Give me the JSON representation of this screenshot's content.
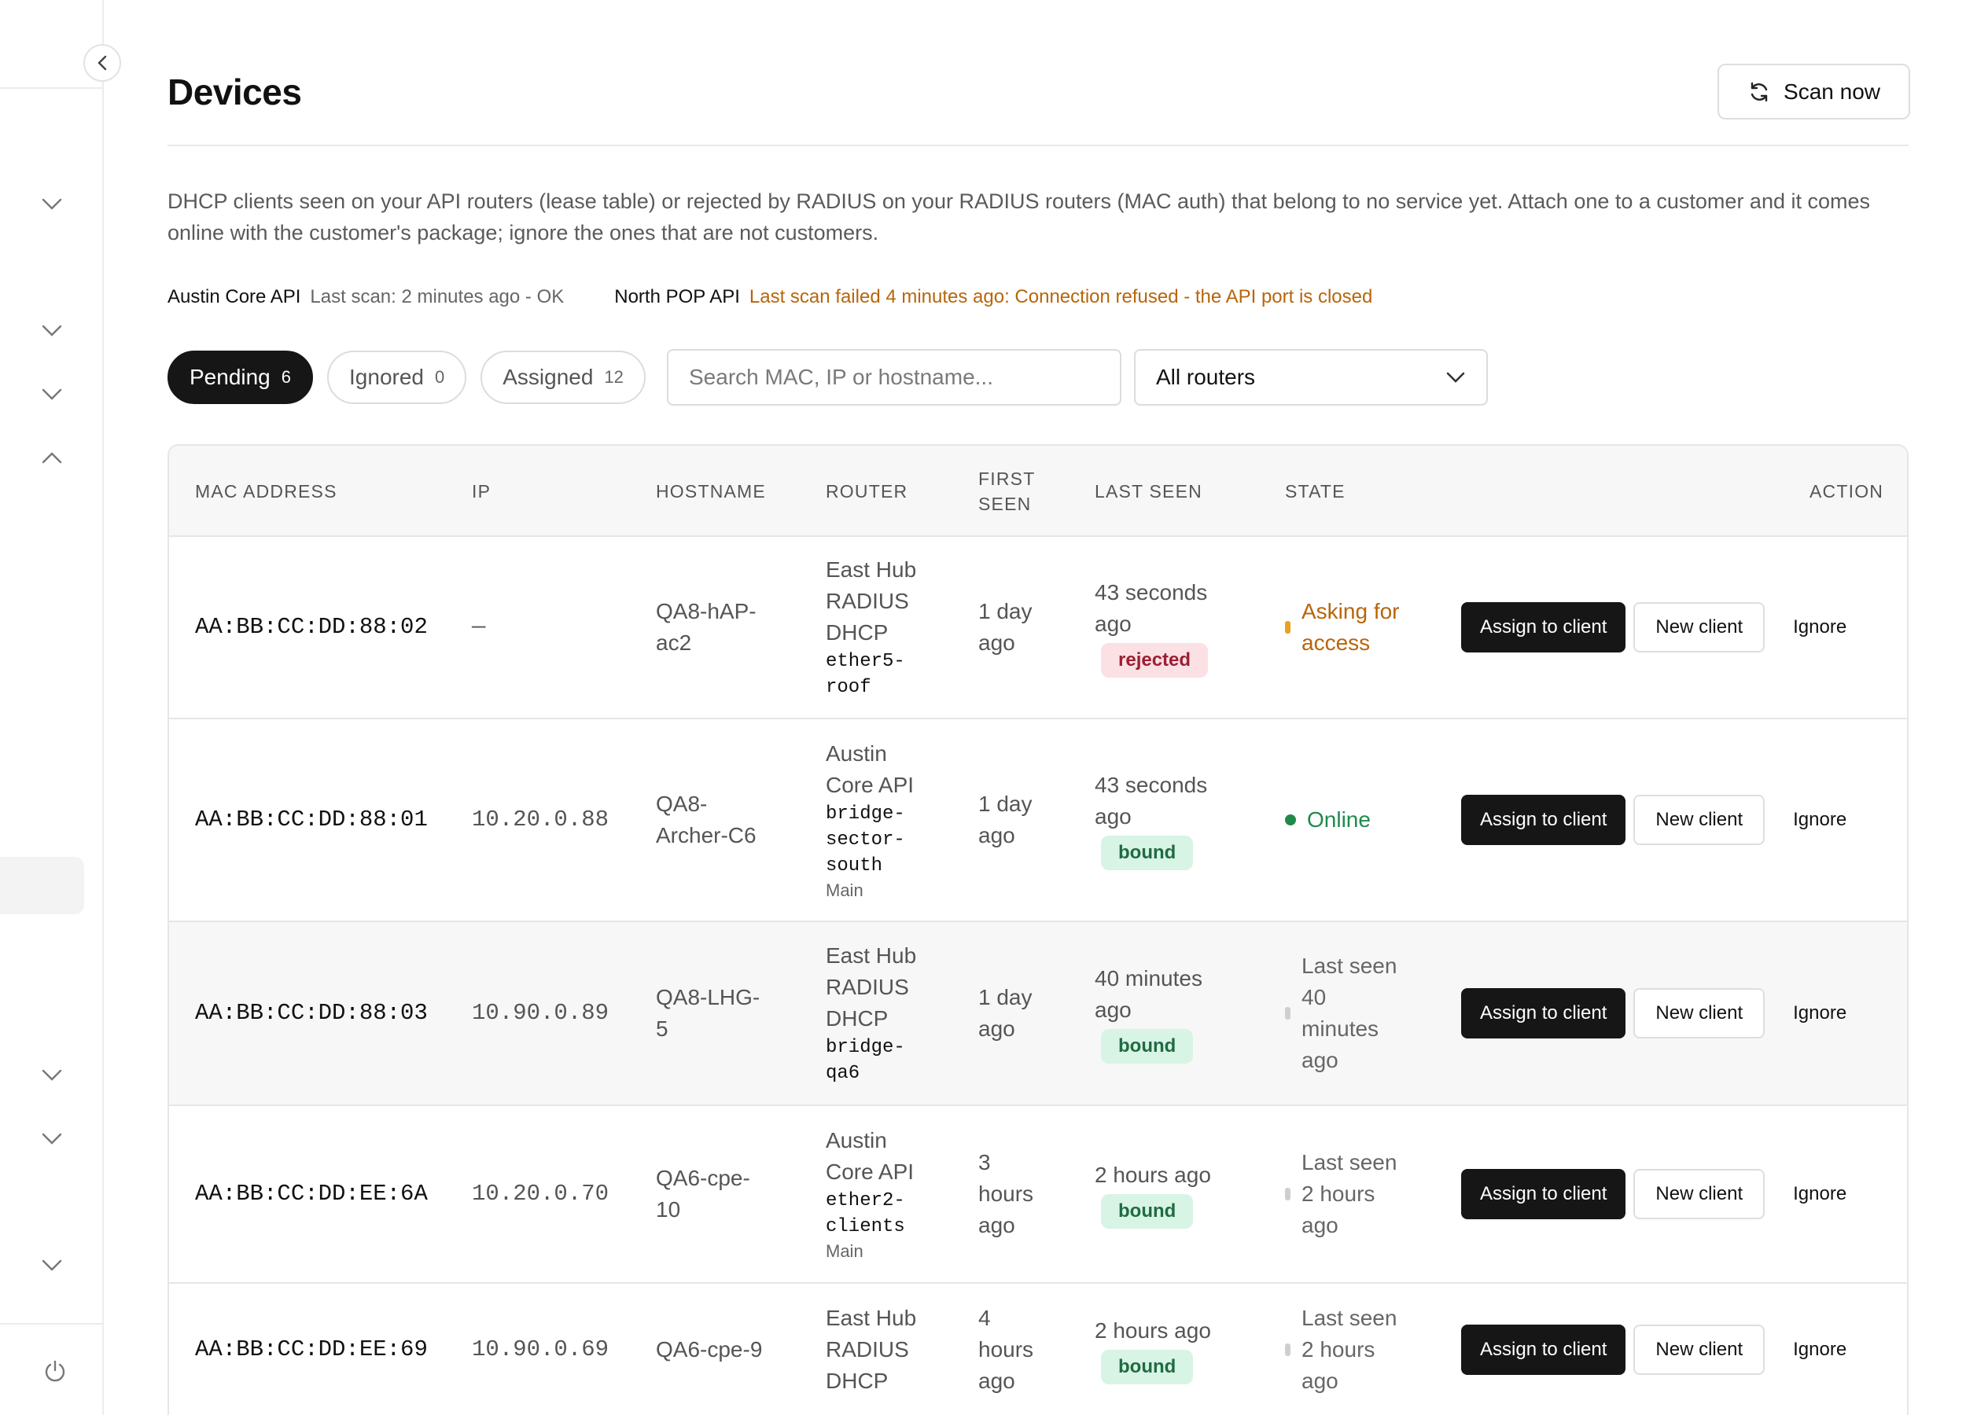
{
  "page": {
    "title": "Devices",
    "scan_label": "Scan now",
    "description": "DHCP clients seen on your API routers (lease table) or rejected by RADIUS on your RADIUS routers (MAC auth) that belong to no service yet. Attach one to a customer and it comes online with the customer's package; ignore the ones that are not customers."
  },
  "router_status": [
    {
      "name": "Austin Core API",
      "status": "Last scan: 2 minutes ago - OK",
      "ok": true
    },
    {
      "name": "North POP API",
      "status": "Last scan failed 4 minutes ago: Connection refused - the API port is closed",
      "ok": false
    }
  ],
  "filters": {
    "tabs": [
      {
        "label": "Pending",
        "count": "6",
        "active": true
      },
      {
        "label": "Ignored",
        "count": "0",
        "active": false
      },
      {
        "label": "Assigned",
        "count": "12",
        "active": false
      }
    ],
    "search_placeholder": "Search MAC, IP or hostname...",
    "router_select": "All routers"
  },
  "table": {
    "headers": {
      "mac": "MAC ADDRESS",
      "ip": "IP",
      "hostname": "HOSTNAME",
      "router": "ROUTER",
      "first_seen_1": "FIRST",
      "first_seen_2": "SEEN",
      "last_seen": "LAST SEEN",
      "state": "STATE",
      "action": "ACTION"
    },
    "action_labels": {
      "assign": "Assign to client",
      "new": "New client",
      "ignore": "Ignore"
    },
    "rows": [
      {
        "mac": "AA:BB:CC:DD:88:02",
        "ip": "—",
        "hostname": [
          "QA8-hAP-",
          "ac2"
        ],
        "router": [
          "East Hub",
          "RADIUS",
          "DHCP"
        ],
        "interface": [
          "ether5-",
          "roof"
        ],
        "router_note": "",
        "first_seen": [
          "1 day",
          "ago"
        ],
        "last_seen": [
          "43 seconds",
          "ago"
        ],
        "badge": "rejected",
        "state": [
          "Asking for",
          "access"
        ],
        "state_kind": "asking",
        "state_color": "#b8650a",
        "highlight": false
      },
      {
        "mac": "AA:BB:CC:DD:88:01",
        "ip": "10.20.0.88",
        "hostname": [
          "QA8-",
          "Archer-C6"
        ],
        "router": [
          "Austin",
          "Core API"
        ],
        "interface": [
          "bridge-",
          "sector-",
          "south"
        ],
        "router_note": "Main",
        "first_seen": [
          "1 day",
          "ago"
        ],
        "last_seen": [
          "43 seconds",
          "ago"
        ],
        "badge": "bound",
        "state": [
          "Online"
        ],
        "state_kind": "online",
        "state_color": "#1f8a4c",
        "highlight": false
      },
      {
        "mac": "AA:BB:CC:DD:88:03",
        "ip": "10.90.0.89",
        "hostname": [
          "QA8-LHG-",
          "5"
        ],
        "router": [
          "East Hub",
          "RADIUS",
          "DHCP"
        ],
        "interface": [
          "bridge-",
          "qa6"
        ],
        "router_note": "",
        "first_seen": [
          "1 day",
          "ago"
        ],
        "last_seen": [
          "40 minutes",
          "ago"
        ],
        "badge": "bound",
        "state": [
          "Last seen",
          "40",
          "minutes",
          "ago"
        ],
        "state_kind": "idle",
        "state_color": "#666666",
        "highlight": true
      },
      {
        "mac": "AA:BB:CC:DD:EE:6A",
        "ip": "10.20.0.70",
        "hostname": [
          "QA6-cpe-",
          "10"
        ],
        "router": [
          "Austin",
          "Core API"
        ],
        "interface": [
          "ether2-",
          "clients"
        ],
        "router_note": "Main",
        "first_seen": [
          "3",
          "hours",
          "ago"
        ],
        "last_seen": [
          "2 hours ago"
        ],
        "badge": "bound",
        "state": [
          "Last seen",
          "2 hours",
          "ago"
        ],
        "state_kind": "idle",
        "state_color": "#666666",
        "highlight": false
      },
      {
        "mac": "AA:BB:CC:DD:EE:69",
        "ip": "10.90.0.69",
        "hostname": [
          "QA6-cpe-9"
        ],
        "router": [
          "East Hub",
          "RADIUS",
          "DHCP"
        ],
        "interface": [],
        "router_note": "",
        "first_seen": [
          "4",
          "hours",
          "ago"
        ],
        "last_seen": [
          "2 hours ago"
        ],
        "badge": "bound",
        "state": [
          "Last seen",
          "2 hours",
          "ago"
        ],
        "state_kind": "idle",
        "state_color": "#666666",
        "highlight": false
      }
    ]
  },
  "colors": {
    "accent_dark": "#161616",
    "bound_bg": "#d8f4e4",
    "rejected_bg": "#fbe0e4",
    "warning": "#b8650a",
    "online": "#1f8a4c"
  },
  "icons": {
    "collapse": "chevron-left-icon",
    "scan": "refresh-icon",
    "select": "chevron-down-icon",
    "power": "power-icon"
  }
}
